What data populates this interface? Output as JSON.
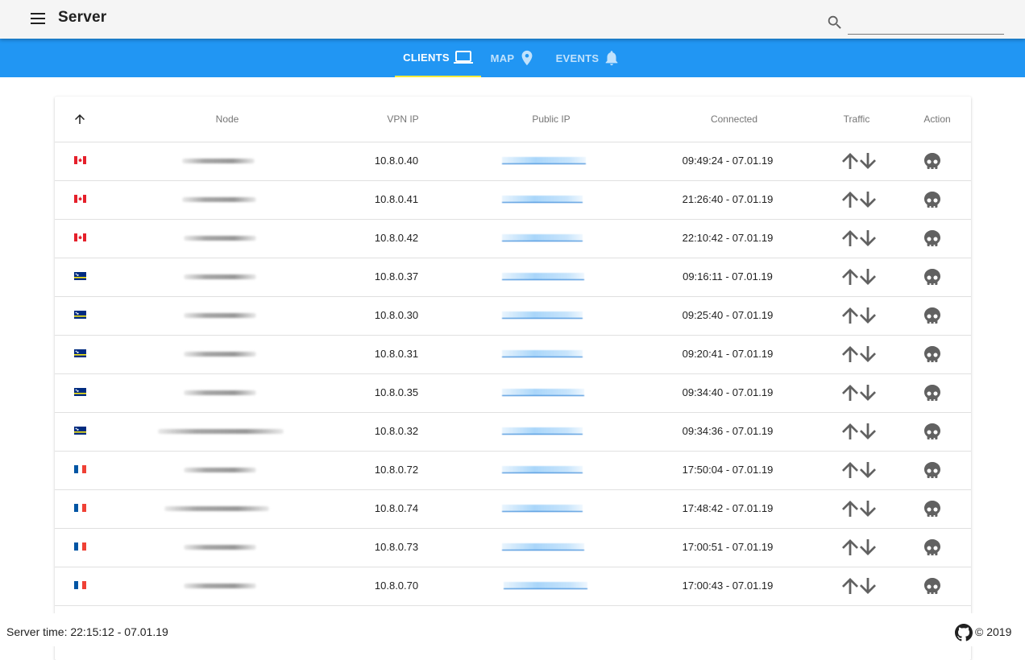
{
  "app": {
    "title": "Server"
  },
  "search": {
    "placeholder": "",
    "value": ""
  },
  "tabs": [
    {
      "label": "CLIENTS",
      "icon": "laptop-icon",
      "active": true
    },
    {
      "label": "MAP",
      "icon": "map-pin-icon",
      "active": false
    },
    {
      "label": "EVENTS",
      "icon": "bell-icon",
      "active": false
    }
  ],
  "table": {
    "sort_icon": "arrow-up-icon",
    "columns": {
      "node": "Node",
      "vpn_ip": "VPN IP",
      "public_ip": "Public IP",
      "connected": "Connected",
      "traffic": "Traffic",
      "action": "Action"
    },
    "rows": [
      {
        "flag": "ca",
        "vpn_ip": "10.8.0.40",
        "connected": "09:49:24 - 07.01.19"
      },
      {
        "flag": "ca",
        "vpn_ip": "10.8.0.41",
        "connected": "21:26:40 - 07.01.19"
      },
      {
        "flag": "ca",
        "vpn_ip": "10.8.0.42",
        "connected": "22:10:42 - 07.01.19"
      },
      {
        "flag": "cw",
        "vpn_ip": "10.8.0.37",
        "connected": "09:16:11 - 07.01.19"
      },
      {
        "flag": "cw",
        "vpn_ip": "10.8.0.30",
        "connected": "09:25:40 - 07.01.19"
      },
      {
        "flag": "cw",
        "vpn_ip": "10.8.0.31",
        "connected": "09:20:41 - 07.01.19"
      },
      {
        "flag": "cw",
        "vpn_ip": "10.8.0.35",
        "connected": "09:34:40 - 07.01.19"
      },
      {
        "flag": "cw",
        "vpn_ip": "10.8.0.32",
        "connected": "09:34:36 - 07.01.19"
      },
      {
        "flag": "fr",
        "vpn_ip": "10.8.0.72",
        "connected": "17:50:04 - 07.01.19"
      },
      {
        "flag": "fr",
        "vpn_ip": "10.8.0.74",
        "connected": "17:48:42 - 07.01.19"
      },
      {
        "flag": "fr",
        "vpn_ip": "10.8.0.73",
        "connected": "17:00:51 - 07.01.19"
      },
      {
        "flag": "fr",
        "vpn_ip": "10.8.0.70",
        "connected": "17:00:43 - 07.01.19"
      }
    ]
  },
  "footer": {
    "server_time": "Server time: 22:15:12 - 07.01.19",
    "copyright": "© 2019"
  },
  "colors": {
    "primary": "#2196f3",
    "tab_indicator": "#ffeb3b",
    "toolbar": "#f5f5f5",
    "link": "#1976d2",
    "icon_grey": "#616161"
  }
}
